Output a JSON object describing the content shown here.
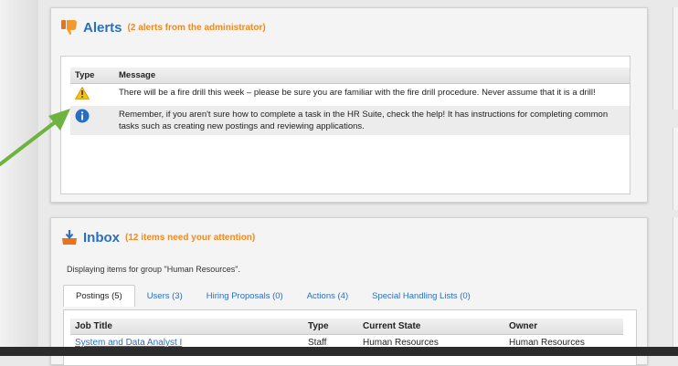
{
  "alerts": {
    "title": "Alerts",
    "subtitle": "(2 alerts from the administrator)",
    "columns": {
      "type": "Type",
      "message": "Message"
    },
    "rows": [
      {
        "icon": "warning-icon",
        "message": "There will be a fire drill this week – please be sure you are familiar with the fire drill procedure. Never assume that it is a drill!"
      },
      {
        "icon": "info-icon",
        "message": "Remember, if you aren't sure how to complete a task in the HR Suite, check the help! It has instructions for completing common tasks such as creating new postings and reviewing applications."
      }
    ]
  },
  "inbox": {
    "title": "Inbox",
    "subtitle": "(12 items need your attention)",
    "description": "Displaying items for group \"Human Resources\".",
    "tabs": [
      "Postings (5)",
      "Users (3)",
      "Hiring Proposals (0)",
      "Actions (4)",
      "Special Handling Lists (0)"
    ],
    "columns": {
      "job_title": "Job Title",
      "type": "Type",
      "state": "Current State",
      "owner": "Owner"
    },
    "rows": [
      {
        "job_title": "System and Data Analyst I",
        "type": "Staff",
        "state": "Human Resources",
        "owner": "Human Resources"
      }
    ]
  },
  "colors": {
    "title_blue": "#2a6fc0",
    "subtitle_orange": "#f08a1e",
    "arrow_green": "#6db33f"
  }
}
